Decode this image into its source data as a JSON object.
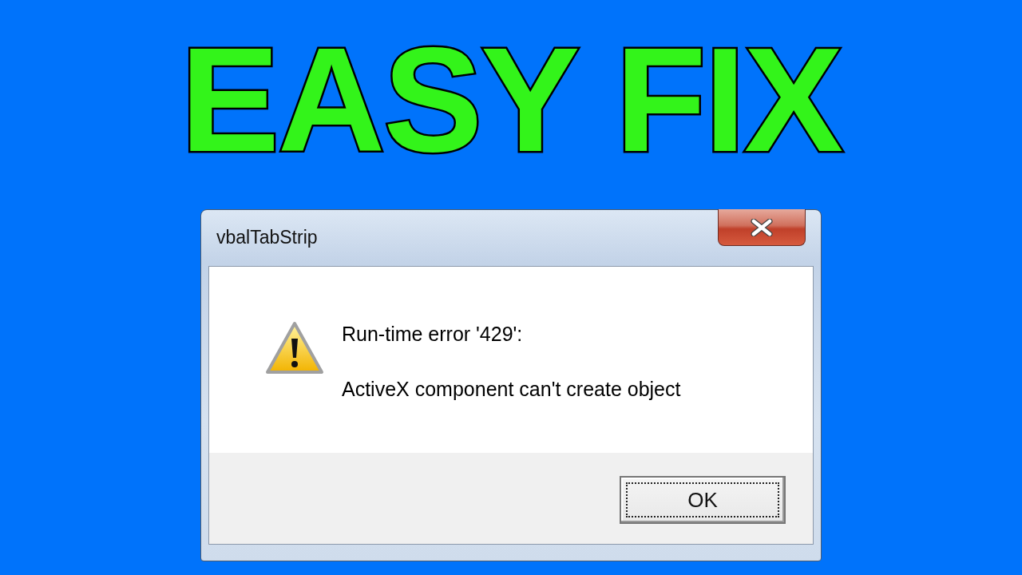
{
  "headline": "EASY FIX",
  "dialog": {
    "title": "vbalTabStrip",
    "message": [
      "Run-time error '429':",
      "ActiveX component can't create object"
    ],
    "buttons": [
      {
        "label": "OK",
        "focused": true
      }
    ]
  }
}
